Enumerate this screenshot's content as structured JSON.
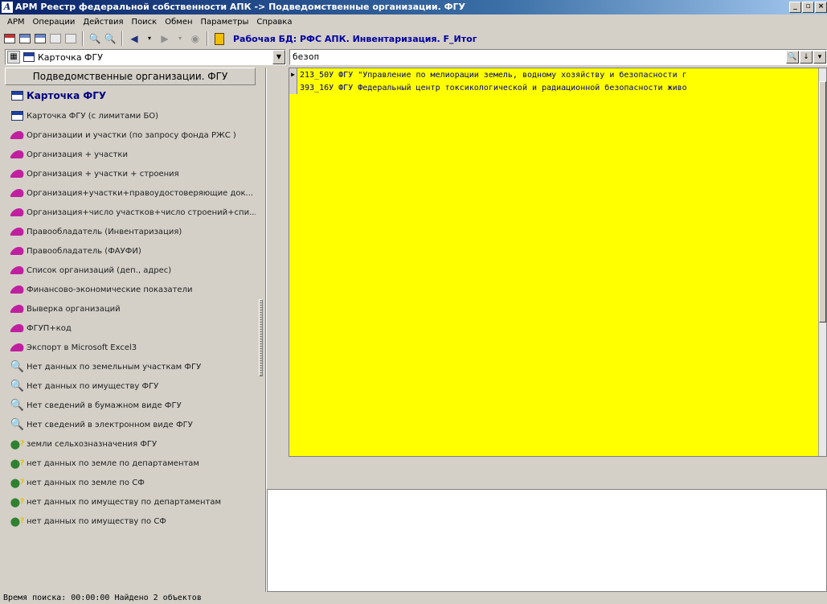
{
  "window": {
    "title": "АРМ Реестр федеральной собственности АПК -> Подведомственные организации. ФГУ"
  },
  "menu": [
    "АРМ",
    "Операции",
    "Действия",
    "Поиск",
    "Обмен",
    "Параметры",
    "Справка"
  ],
  "toolbar": {
    "db_label": "Рабочая БД: РФС АПК. Инвентаризация. F_Итог"
  },
  "left_combo": {
    "value": "Карточка ФГУ"
  },
  "search": {
    "value": "безоп"
  },
  "left_panel": {
    "header": "Подведомственные организации. ФГУ",
    "items": [
      {
        "label": "Карточка ФГУ",
        "icon": "card-icon"
      },
      {
        "label": "Карточка ФГУ (с лимитами БО)",
        "icon": "card-icon"
      },
      {
        "label": "Организации и участки (по запросу фонда РЖС )",
        "icon": "arrow-icon"
      },
      {
        "label": "Организация + участки",
        "icon": "arrow-icon"
      },
      {
        "label": "Организация + участки + строения",
        "icon": "arrow-icon"
      },
      {
        "label": "Организация+участки+правоудостоверяющие док...",
        "icon": "arrow-icon"
      },
      {
        "label": "Организация+число участков+число строений+спи...",
        "icon": "arrow-icon"
      },
      {
        "label": "Правообладатель (Инвентаризация)",
        "icon": "arrow-icon"
      },
      {
        "label": "Правообладатель (ФАУФИ)",
        "icon": "arrow-icon"
      },
      {
        "label": "Список организаций (деп., адрес)",
        "icon": "arrow-icon"
      },
      {
        "label": "Финансово-экономические показатели",
        "icon": "arrow-icon"
      },
      {
        "label": "Выверка организаций",
        "icon": "arrow-icon"
      },
      {
        "label": "ФГУП+код",
        "icon": "arrow-icon"
      },
      {
        "label": "Экспорт в Microsoft Excel3",
        "icon": "arrow-icon"
      },
      {
        "label": "Нет данных по земельным участкам ФГУ",
        "icon": "magnifier-icon"
      },
      {
        "label": "Нет данных по имуществу ФГУ",
        "icon": "magnifier-icon"
      },
      {
        "label": "Нет сведений в бумажном виде ФГУ",
        "icon": "magnifier-icon"
      },
      {
        "label": "Нет сведений в электронном виде ФГУ",
        "icon": "magnifier-icon"
      },
      {
        "label": "земли сельхозназначения ФГУ",
        "icon": "query-icon"
      },
      {
        "label": "нет данных по земле по департаментам",
        "icon": "query-icon"
      },
      {
        "label": "нет данных по земле по СФ",
        "icon": "query-icon"
      },
      {
        "label": "нет данных по имуществу по департаментам",
        "icon": "query-icon"
      },
      {
        "label": "нет данных по имуществу по СФ",
        "icon": "query-icon"
      }
    ]
  },
  "results": {
    "rows": [
      "213_50У ФГУ \"Управление по мелиорации земель, водному хозяйству и безопасности г",
      "393_16У ФГУ Федеральный центр токсикологической и радиационной безопасности живо"
    ],
    "background": "#ffff00"
  },
  "status": {
    "text": "Время поиска: 00:00:00 Найдено 2 объектов"
  }
}
